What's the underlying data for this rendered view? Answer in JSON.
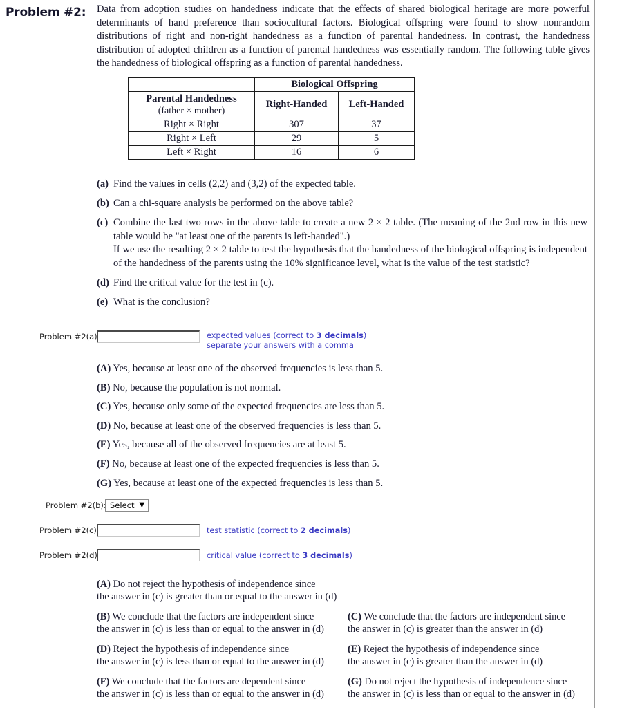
{
  "header": {
    "problem_label": "Problem #2:",
    "intro": "Data from adoption studies on handedness indicate that the effects of shared biological heritage are more powerful determinants of hand preference than sociocultural factors. Biological offspring were found to show nonrandom distributions of right and non-right handedness as a function of parental handedness. In contrast, the handedness distribution of adopted children as a function of parental handedness was essentially random. The following table gives the handedness of biological offspring as a function of parental handedness."
  },
  "table": {
    "group_header": "Biological Offspring",
    "row_header_main": "Parental Handedness",
    "row_header_sub": "(father × mother)",
    "columns": [
      "Right-Handed",
      "Left-Handed"
    ],
    "rows": [
      {
        "category": "Right × Right",
        "right_handed": "307",
        "left_handed": "37"
      },
      {
        "category": "Right × Left",
        "right_handed": "29",
        "left_handed": "5"
      },
      {
        "category": "Left × Right",
        "right_handed": "16",
        "left_handed": "6"
      }
    ]
  },
  "parts": {
    "a_tag": "(a)",
    "a_text": "Find the values in cells (2,2) and (3,2) of the expected table.",
    "b_tag": "(b)",
    "b_text": "Can a chi-square analysis be performed on the above table?",
    "c_tag": "(c)",
    "c_text_1": "Combine the last two rows in the above table to create a new 2 × 2 table. (The meaning of the 2nd row in this new table would be \"at least one of the parents is left-handed\".)",
    "c_text_2": "If we use the resulting 2 × 2 table to test the hypothesis that the handedness of the biological offspring is independent of the handedness of the parents using the 10% significance level, what is the value of the test statistic?",
    "d_tag": "(d)",
    "d_text": "Find the critical value for the test in (c).",
    "e_tag": "(e)",
    "e_text": "What is the conclusion?"
  },
  "answers": {
    "a": {
      "label": "Problem #2(a):",
      "value": "",
      "placeholder": "",
      "hint_line1_pre": "expected values (correct to ",
      "hint_line1_bold": "3 decimals",
      "hint_line1_post": ")",
      "hint_line2": "separate your answers with a comma"
    },
    "b": {
      "label": "Problem #2(b):",
      "selected": "Select",
      "caret": "▼"
    },
    "c": {
      "label": "Problem #2(c):",
      "value": "",
      "placeholder": "",
      "hint_pre": "test statistic (correct to ",
      "hint_bold": "2 decimals",
      "hint_post": ")"
    },
    "d": {
      "label": "Problem #2(d):",
      "value": "",
      "placeholder": "",
      "hint_pre": "critical value (correct to ",
      "hint_bold": "3 decimals",
      "hint_post": ")"
    }
  },
  "choices_b": [
    {
      "tag": "(A)",
      "text": "Yes, because at least one of the observed frequencies is less than 5."
    },
    {
      "tag": "(B)",
      "text": "No, because the population is not normal."
    },
    {
      "tag": "(C)",
      "text": "Yes, because only some of the expected frequencies are less than 5."
    },
    {
      "tag": "(D)",
      "text": "No, because at least one of the observed frequencies is less than 5."
    },
    {
      "tag": "(E)",
      "text": "Yes, because all of the observed frequencies are at least 5."
    },
    {
      "tag": "(F)",
      "text": "No, because at least one of the expected frequencies is less than 5."
    },
    {
      "tag": "(G)",
      "text": "Yes, because at least one of the expected frequencies is less than 5."
    }
  ],
  "choices_e": [
    {
      "tag": "(A)",
      "line1": "Do not reject the hypothesis of independence since",
      "line2": "the answer in (c) is greater than or equal to the answer in (d)"
    },
    {
      "tag": "(B)",
      "line1": "We conclude that the factors are independent since",
      "line2": "the answer in (c) is less than or equal to the answer in (d)"
    },
    {
      "tag": "(C)",
      "line1": "We conclude that the factors are independent since",
      "line2": "the answer in (c) is greater than the answer in (d)"
    },
    {
      "tag": "(D)",
      "line1": "Reject the hypothesis of independence since",
      "line2": "the answer in (c) is less than or equal to the answer in (d)"
    },
    {
      "tag": "(E)",
      "line1": "Reject the hypothesis of independence since",
      "line2": "the answer in (c) is greater than the answer in (d)"
    },
    {
      "tag": "(F)",
      "line1": "We conclude that the factors are dependent since",
      "line2": "the answer in (c) is less than or equal to the answer in (d)"
    },
    {
      "tag": "(G)",
      "line1": "Do not reject the hypothesis of independence since",
      "line2": "the answer in (c) is less than or equal to the answer in (d)"
    }
  ],
  "colors": {
    "hint_blue": "#3d3dc4",
    "text": "#1a1a2e",
    "rule": "#9a9a9a"
  }
}
